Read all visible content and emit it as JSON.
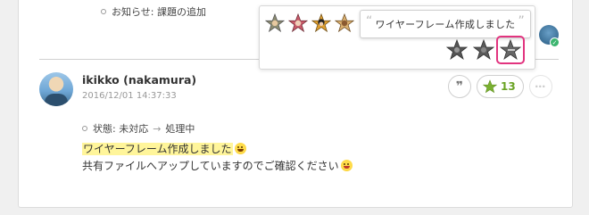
{
  "previous": {
    "notice_text": "お知らせ: 課題の追加"
  },
  "stamp_popup": {
    "quote_text": "ワイヤーフレーム作成しました",
    "stampers": [
      "stamper-1",
      "stamper-2",
      "stamper-3",
      "stamper-4"
    ],
    "stamp_options": [
      "star-stamp-1",
      "star-stamp-2",
      "star-stamp-3"
    ],
    "selected_stamp_index": 2
  },
  "comment": {
    "author": "ikikko (nakamura)",
    "timestamp": "2016/12/01 14:37:33",
    "status_from": "状態: 未対応",
    "status_arrow": "→",
    "status_to": "処理中",
    "message_line1": "ワイヤーフレーム作成しました",
    "message_line2": "共有ファイルへアップしていますのでご確認ください",
    "star_count": "13",
    "quote_icon": "❞",
    "more_icon": "⋯"
  },
  "colors": {
    "star_green": "#6aa324",
    "highlight": "#fff59a",
    "selection_pink": "#e2347f",
    "online_green": "#3bb56f"
  }
}
